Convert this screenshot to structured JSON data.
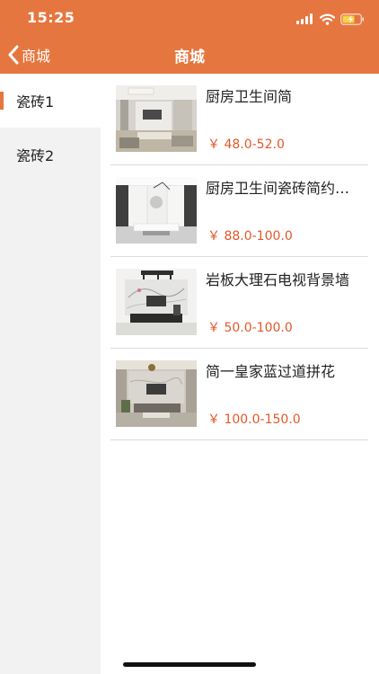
{
  "status_bar": {
    "time": "15:25",
    "icons": [
      "cellular-signal-icon",
      "wifi-icon",
      "battery-charging-icon"
    ]
  },
  "nav": {
    "back_icon": "chevron-left-icon",
    "back_label": "商城",
    "title": "商城"
  },
  "sidebar": {
    "items": [
      {
        "label": "瓷砖1",
        "active": true
      },
      {
        "label": "瓷砖2",
        "active": false
      }
    ]
  },
  "products": [
    {
      "name": "厨房卫生间简",
      "price": "￥ 48.0-52.0"
    },
    {
      "name": "厨房卫生间瓷砖简约现代",
      "price": "￥ 88.0-100.0"
    },
    {
      "name": "岩板大理石电视背景墙",
      "price": "￥ 50.0-100.0"
    },
    {
      "name": "简一皇家蓝过道拼花",
      "price": "￥ 100.0-150.0"
    }
  ],
  "colors": {
    "accent": "#e6763f",
    "price": "#e2582a",
    "sidebar_bg": "#f2f2f2"
  }
}
